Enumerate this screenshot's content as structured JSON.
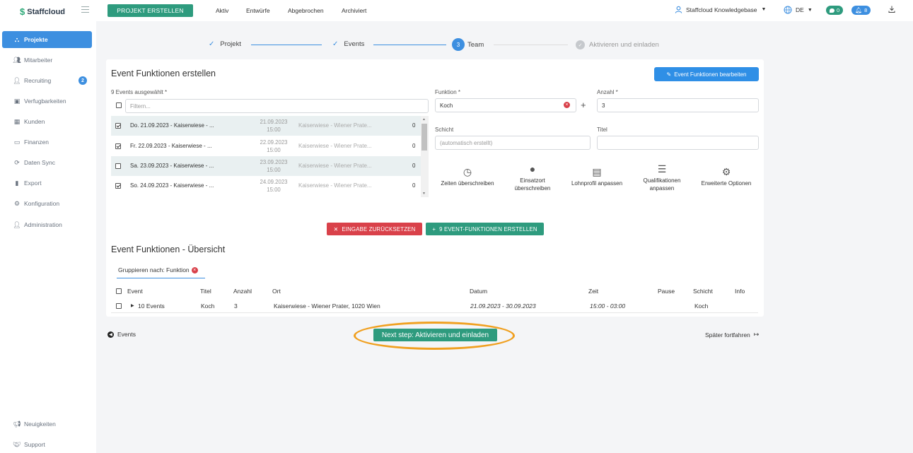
{
  "app": {
    "logo": "Staffcloud"
  },
  "topbar": {
    "create_button": "PROJEKT ERSTELLEN",
    "nav": [
      "Aktiv",
      "Entwürfe",
      "Abgebrochen",
      "Archiviert"
    ],
    "user": "Staffcloud Knowledgebase",
    "language": "DE",
    "messages_count": "0",
    "notifications_count": "8"
  },
  "sidebar": {
    "items": [
      {
        "label": "Projekte",
        "icon": "sitemap-icon",
        "active": true
      },
      {
        "label": "Mitarbeiter",
        "icon": "users-icon"
      },
      {
        "label": "Recruiting",
        "icon": "user-plus-icon",
        "badge": "2"
      },
      {
        "label": "Verfugbarkeiten",
        "icon": "calendar-icon"
      },
      {
        "label": "Kunden",
        "icon": "building-icon"
      },
      {
        "label": "Finanzen",
        "icon": "money-icon"
      },
      {
        "label": "Daten Sync",
        "icon": "sync-icon"
      },
      {
        "label": "Export",
        "icon": "file-icon"
      },
      {
        "label": "Konfiguration",
        "icon": "gear-icon"
      },
      {
        "label": "Administration",
        "icon": "user-cog-icon"
      }
    ],
    "bottom": [
      {
        "label": "Neuigkeiten",
        "icon": "bullhorn-icon"
      },
      {
        "label": "Support",
        "icon": "handshake-icon"
      }
    ]
  },
  "stepper": {
    "steps": [
      {
        "label": "Projekt",
        "state": "done"
      },
      {
        "label": "Events",
        "state": "done"
      },
      {
        "label": "Team",
        "state": "current",
        "number": "3"
      },
      {
        "label": "Aktivieren und einladen",
        "state": "pending"
      }
    ]
  },
  "form": {
    "title": "Event Funktionen erstellen",
    "edit_button": "Event Funktionen bearbeiten",
    "events_label": "9 Events ausgewählt *",
    "filter_placeholder": "Filtern...",
    "events": [
      {
        "name": "Do. 21.09.2023 - Kaiserwiese - ...",
        "date": "21.09.2023",
        "time": "15:00",
        "location": "Kaiserwiese - Wiener Prate...",
        "count": "0",
        "checked": true
      },
      {
        "name": "Fr. 22.09.2023 - Kaiserwiese - ...",
        "date": "22.09.2023",
        "time": "15:00",
        "location": "Kaiserwiese - Wiener Prate...",
        "count": "0",
        "checked": true
      },
      {
        "name": "Sa. 23.09.2023 - Kaiserwiese - ...",
        "date": "23.09.2023",
        "time": "15:00",
        "location": "Kaiserwiese - Wiener Prate...",
        "count": "0",
        "checked": false
      },
      {
        "name": "So. 24.09.2023 - Kaiserwiese - ...",
        "date": "24.09.2023",
        "time": "15:00",
        "location": "Kaiserwiese - Wiener Prate...",
        "count": "0",
        "checked": true
      }
    ],
    "funktion_label": "Funktion *",
    "funktion_value": "Koch",
    "anzahl_label": "Anzahl *",
    "anzahl_value": "3",
    "schicht_label": "Schicht",
    "schicht_placeholder": "(automatisch erstellt)",
    "titel_label": "Titel",
    "options": [
      {
        "line1": "Zeiten überschreiben",
        "line2": "",
        "icon": "clock-icon"
      },
      {
        "line1": "Einsatzort",
        "line2": "überschreiben",
        "icon": "map-marker-icon"
      },
      {
        "line1": "Lohnprofil anpassen",
        "line2": "",
        "icon": "money-bill-icon"
      },
      {
        "line1": "Qualifikationen",
        "line2": "anpassen",
        "icon": "server-icon"
      },
      {
        "line1": "Erweiterte Optionen",
        "line2": "",
        "icon": "cogs-icon"
      }
    ],
    "reset_button": "EINGABE ZURÜCKSETZEN",
    "create_button": "9 EVENT-FUNKTIONEN ERSTELLEN"
  },
  "overview": {
    "title": "Event Funktionen - Übersicht",
    "group_by": "Gruppieren nach: Funktion",
    "columns": [
      "Event",
      "Titel",
      "Anzahl",
      "Ort",
      "Datum",
      "Zeit",
      "Pause",
      "Schicht",
      "Info"
    ],
    "rows": [
      {
        "event": "10 Events",
        "titel": "Koch",
        "anzahl": "3",
        "ort": "Kaiserwiese - Wiener Prater, 1020 Wien",
        "datum": "21.09.2023 - 30.09.2023",
        "zeit": "15:00 - 03:00",
        "pause": "",
        "schicht": "Koch",
        "info": ""
      }
    ]
  },
  "footer": {
    "back": "Events",
    "next": "Next step: Aktivieren und einladen",
    "later": "Später fortfahren"
  },
  "colors": {
    "primary": "#3d8fe0",
    "green": "#2e9b7e",
    "red": "#d9414a",
    "highlight": "#f0a020"
  }
}
